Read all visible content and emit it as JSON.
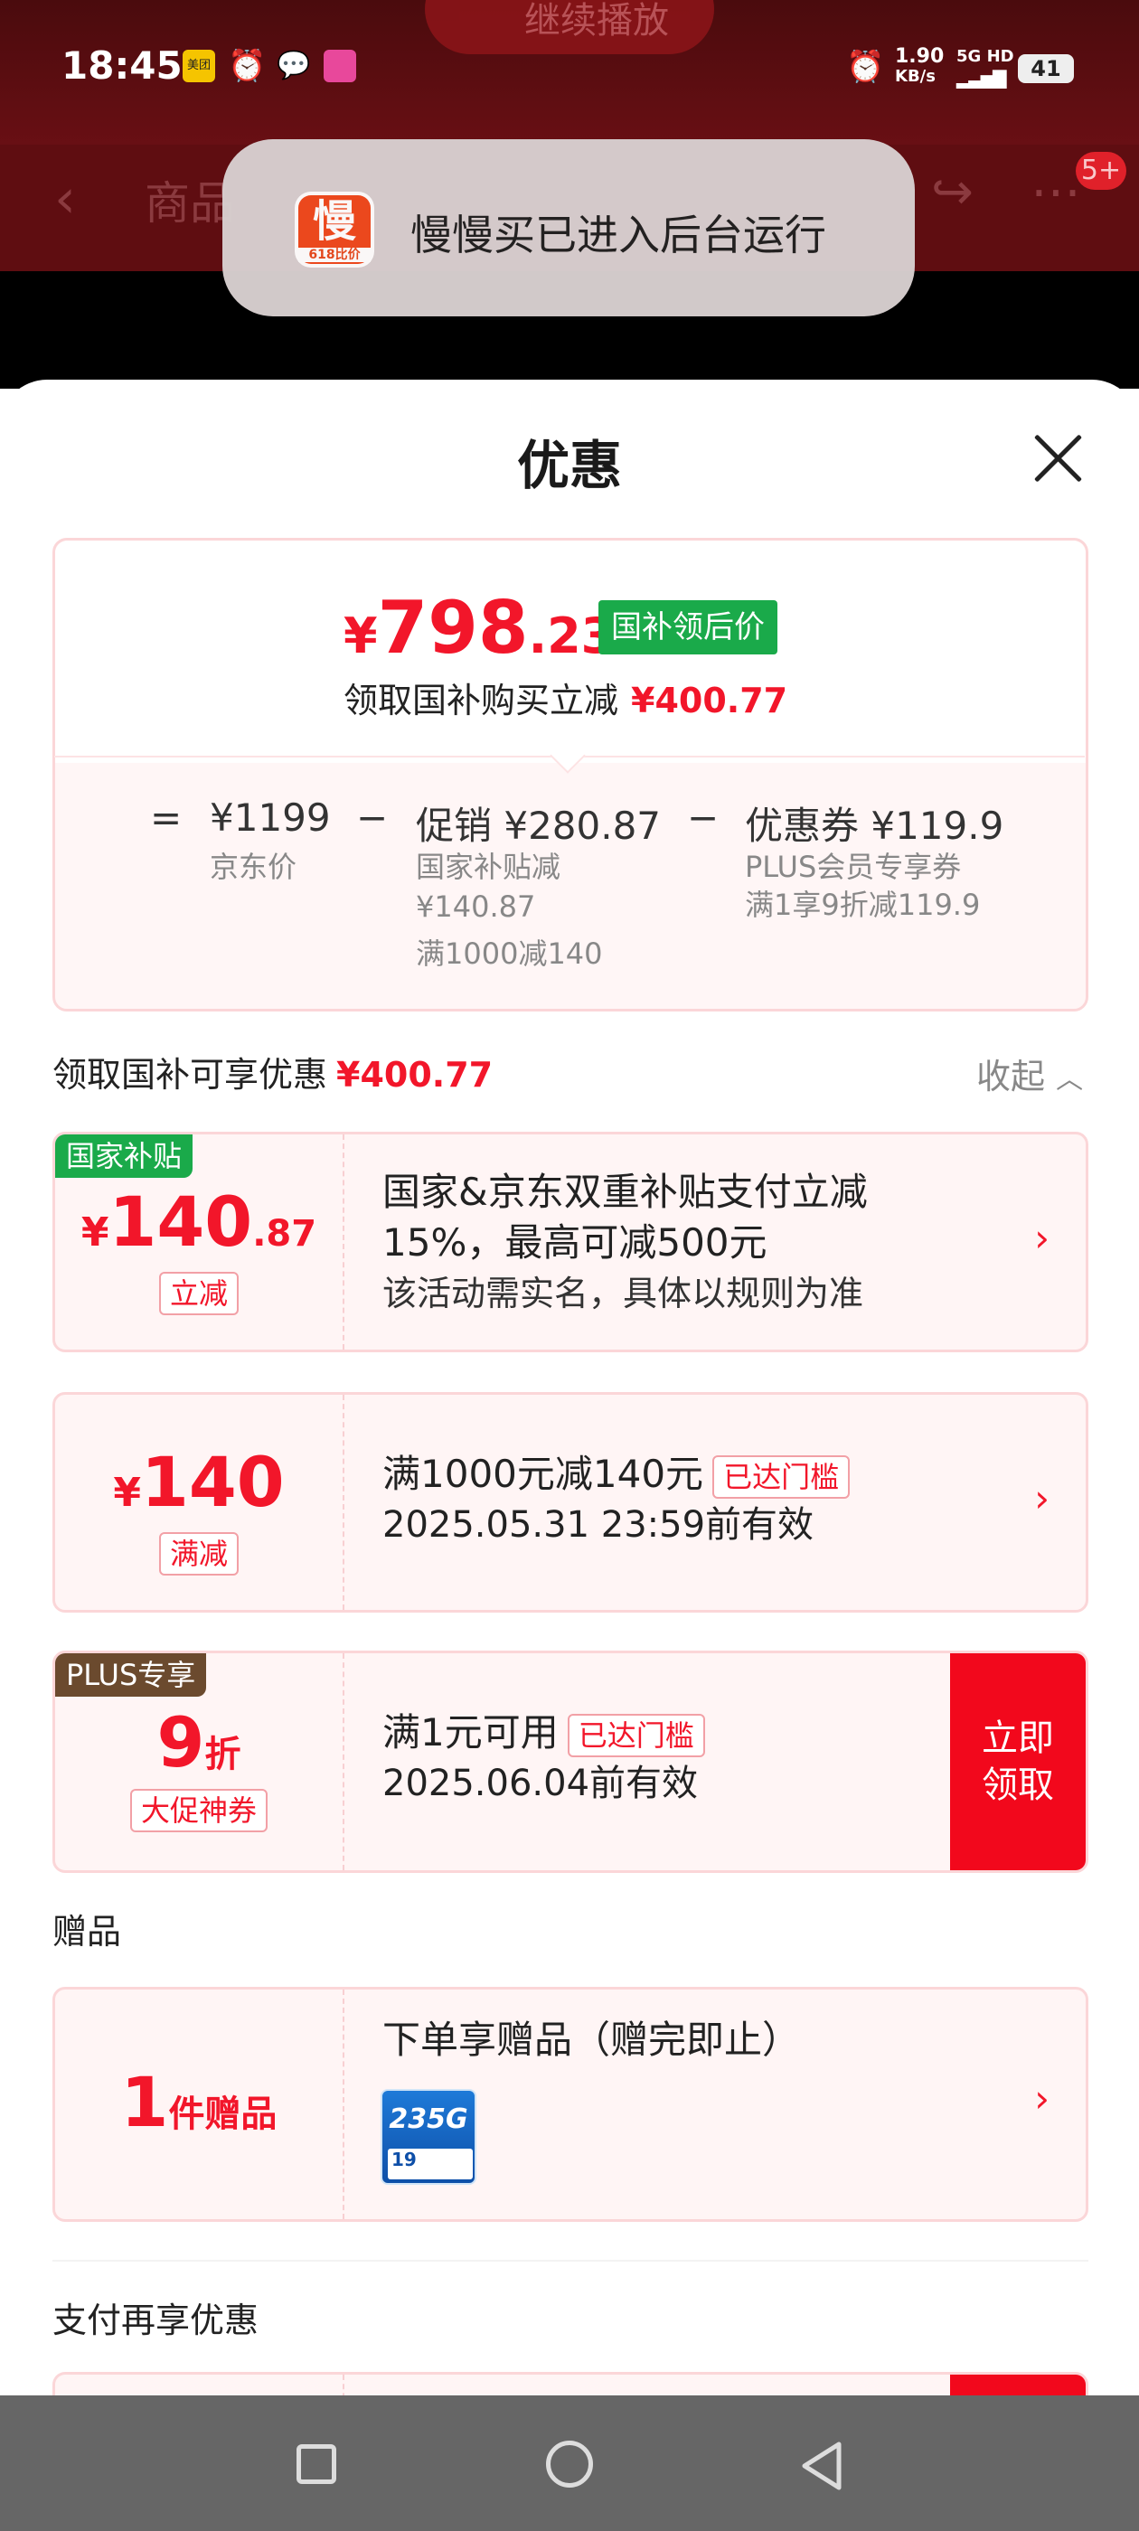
{
  "status_bar": {
    "time": "18:45",
    "app_icons": [
      "美团",
      "alarm-icon",
      "wechat-icon",
      "app-icon"
    ],
    "speed_value": "1.90",
    "speed_unit": "KB/s",
    "network": "5G HD",
    "battery": "41"
  },
  "background_app": {
    "play_label": "继续播放",
    "nav_title": "商品",
    "badge": "5+"
  },
  "toast": {
    "logo_char": "慢",
    "logo_sub": "618比价",
    "text": "慢慢买已进入后台运行"
  },
  "sheet": {
    "title": "优惠"
  },
  "summary": {
    "price_symbol": "¥",
    "price_int": "798",
    "price_dec": ".23",
    "price_tag": "国补领后价",
    "subline_label": "领取国补购买立减",
    "subline_value": "¥400.77",
    "formula": {
      "eq": "=",
      "jd_price": "¥1199",
      "jd_label": "京东价",
      "minus1": "−",
      "promo": "促销 ¥280.87",
      "promo_line1": "国家补贴减",
      "promo_line2": "¥140.87",
      "promo_line3": "满1000减140",
      "minus2": "−",
      "coupon": "优惠券 ¥119.9",
      "coupon_line1": "PLUS会员专享券",
      "coupon_line2": "满1享9折减119.9"
    }
  },
  "section1": {
    "label": "领取国补可享优惠",
    "value": "¥400.77",
    "collapse_label": "收起",
    "collapse_icon": "chevron-up-icon"
  },
  "coupons": [
    {
      "corner": "国家补贴",
      "amount_symbol": "¥",
      "amount_int": "140",
      "amount_dec": ".87",
      "tag": "立减",
      "line1": "国家&京东双重补贴支付立减",
      "line2": "15%，最高可减500元",
      "line3": "该活动需实名，具体以规则为准",
      "arrow": "›"
    },
    {
      "amount_symbol": "¥",
      "amount_int": "140",
      "tag": "满减",
      "line1": "满1000元减140元",
      "badge": "已达门槛",
      "line2": "2025.05.31 23:59前有效",
      "arrow": "›"
    },
    {
      "corner": "PLUS专享",
      "amount_int": "9",
      "amount_unit": "折",
      "tag": "大促神券",
      "line1": "满1元可用",
      "badge": "已达门槛",
      "line2": "2025.06.04前有效",
      "button": "立即领取"
    }
  ],
  "gifts": {
    "label": "赠品",
    "count": "1",
    "unit": "件赠品",
    "title": "下单享赠品（赠完即止）",
    "thumb_text": "235G",
    "thumb_price": "19",
    "arrow": "›"
  },
  "section2": {
    "label": "支付再享优惠"
  },
  "colors": {
    "accent_red": "#f2162a",
    "green_tag": "#1aaa4a",
    "corner_green": "#1aaa4a",
    "corner_plus": "#6b4a2e",
    "card_border": "#fbd6d8",
    "card_bg": "#fff5f5"
  },
  "nav_bar": {
    "recents": "square-icon",
    "home": "circle-icon",
    "back": "triangle-back-icon"
  }
}
